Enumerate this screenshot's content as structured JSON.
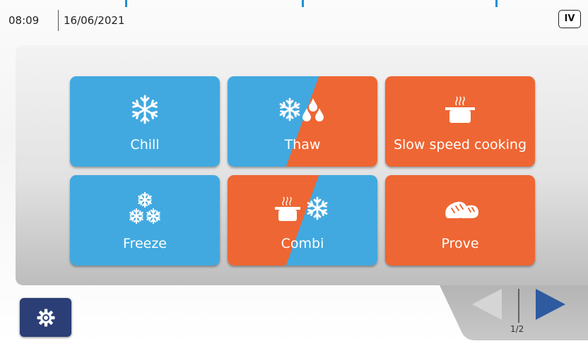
{
  "status_bar": {
    "time": "08:09",
    "date": "16/06/2021",
    "level_badge": "IV"
  },
  "tiles": [
    {
      "label": "Chill",
      "icon": "snowflake-icon",
      "color": "#41a9e0"
    },
    {
      "label": "Thaw",
      "icon": "snowflake-drops-icon",
      "colors": [
        "#41a9e0",
        "#ee6633"
      ]
    },
    {
      "label": "Slow speed cooking",
      "icon": "pot-steam-icon",
      "color": "#ee6633"
    },
    {
      "label": "Freeze",
      "icon": "three-snowflakes-icon",
      "color": "#41a9e0"
    },
    {
      "label": "Combi",
      "icon": "pot-snowflake-icon",
      "colors": [
        "#ee6633",
        "#41a9e0"
      ]
    },
    {
      "label": "Prove",
      "icon": "bread-icon",
      "color": "#ee6633"
    }
  ],
  "settings": {
    "icon": "gear-icon",
    "color": "#2c3e76"
  },
  "pagination": {
    "page": "1/2",
    "prev_icon": "prev-arrow-icon",
    "next_icon": "next-arrow-icon",
    "prev_color": "#d5d5d5",
    "next_color": "#2e5aa0"
  }
}
